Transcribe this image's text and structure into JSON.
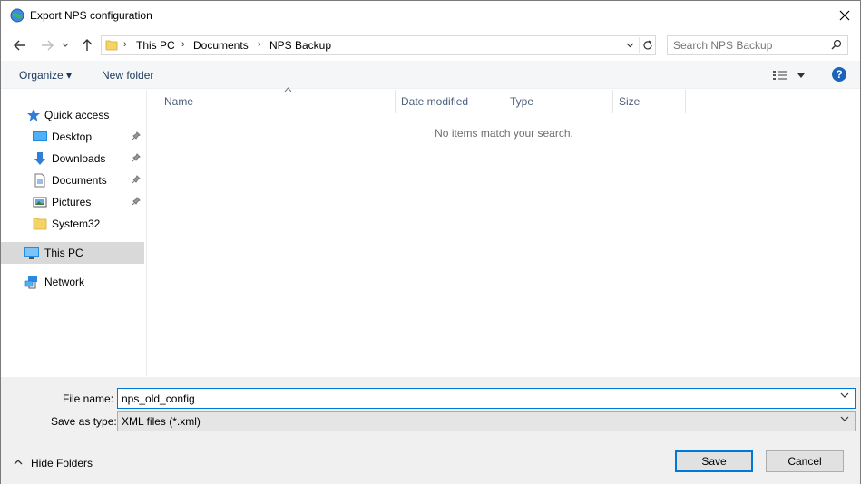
{
  "window": {
    "title": "Export NPS configuration"
  },
  "nav": {
    "breadcrumbs": [
      "This PC",
      "Documents",
      "NPS Backup"
    ],
    "search_placeholder": "Search NPS Backup"
  },
  "toolbar": {
    "organize_label": "Organize ▾",
    "new_folder_label": "New folder",
    "help_label": "?"
  },
  "sidebar": {
    "items": [
      {
        "label": "Quick access",
        "icon": "star-icon"
      },
      {
        "label": "Desktop",
        "icon": "desktop-icon",
        "pinned": true
      },
      {
        "label": "Downloads",
        "icon": "download-icon",
        "pinned": true
      },
      {
        "label": "Documents",
        "icon": "documents-icon",
        "pinned": true
      },
      {
        "label": "Pictures",
        "icon": "pictures-icon",
        "pinned": true
      },
      {
        "label": "System32",
        "icon": "folder-icon"
      },
      {
        "label": "This PC",
        "icon": "computer-icon",
        "selected": true
      },
      {
        "label": "Network",
        "icon": "network-icon"
      }
    ]
  },
  "filelist": {
    "columns": [
      "Name",
      "Date modified",
      "Type",
      "Size"
    ],
    "empty_message": "No items match your search."
  },
  "form": {
    "file_name_label": "File name:",
    "file_name_value": "nps_old_config",
    "save_type_label": "Save as type:",
    "save_type_value": "XML files (*.xml)"
  },
  "footer": {
    "hide_folders_label": "Hide Folders",
    "save_label": "Save",
    "cancel_label": "Cancel"
  },
  "colors": {
    "accent": "#0078d7",
    "selected_bg": "#d9d9d9",
    "command_bar_bg": "#f5f6f7",
    "bottom_bg": "#f0f0f0"
  }
}
